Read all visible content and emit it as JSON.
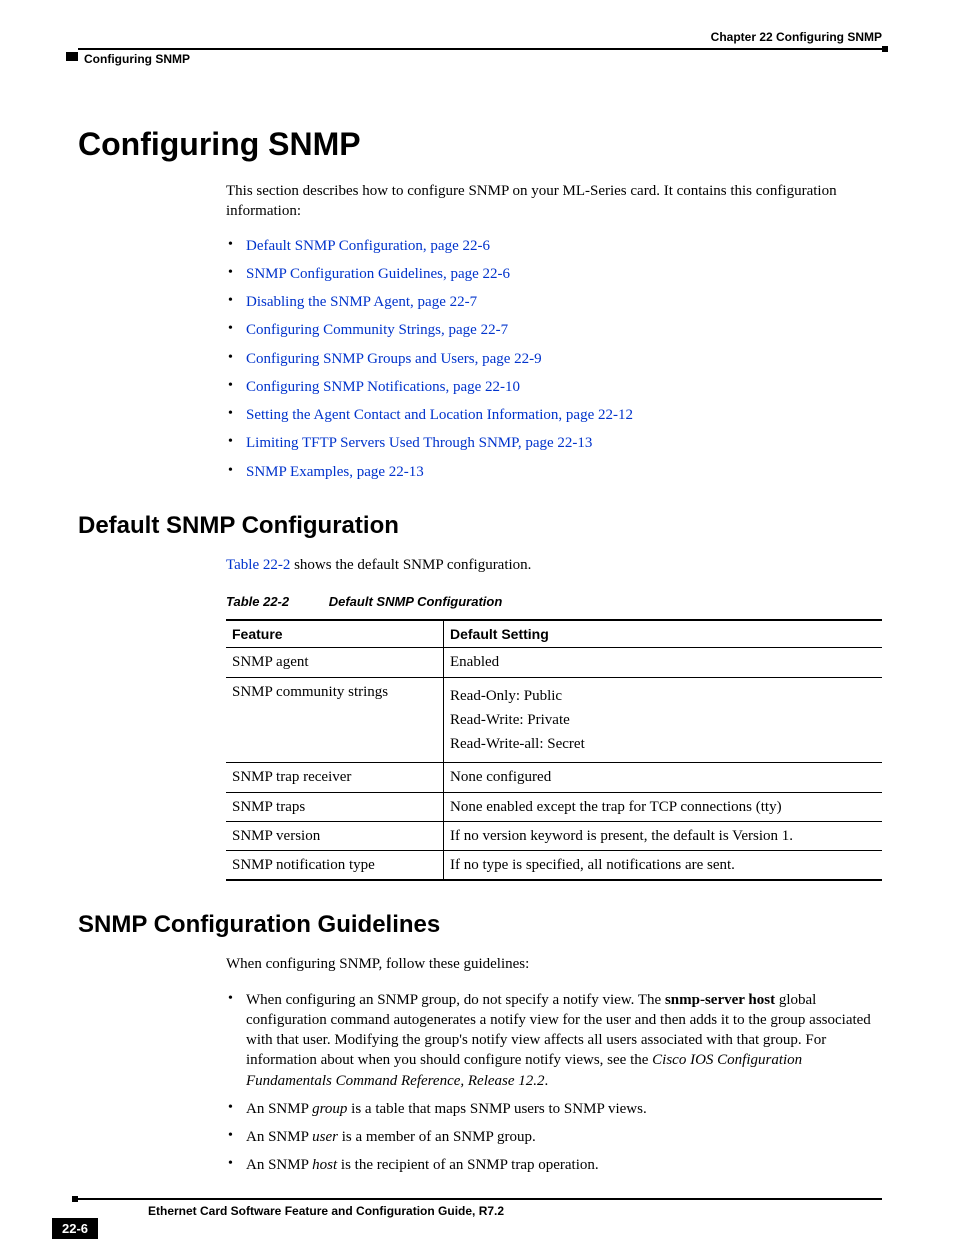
{
  "header": {
    "chapter": "Chapter 22 Configuring SNMP",
    "section": "Configuring SNMP"
  },
  "title": "Configuring SNMP",
  "intro": "This section describes how to configure SNMP on your ML-Series card. It contains this configuration information:",
  "toc": [
    "Default SNMP Configuration, page 22-6",
    "SNMP Configuration Guidelines, page 22-6",
    "Disabling the SNMP Agent, page 22-7",
    "Configuring Community Strings, page 22-7",
    "Configuring SNMP Groups and Users, page 22-9",
    "Configuring SNMP Notifications, page 22-10",
    "Setting the Agent Contact and Location Information, page 22-12",
    "Limiting TFTP Servers Used Through SNMP, page 22-13",
    "SNMP Examples, page 22-13"
  ],
  "section1": {
    "title": "Default SNMP Configuration",
    "lead_link": "Table 22-2",
    "lead_rest": " shows the default SNMP configuration.",
    "caption_no": "Table 22-2",
    "caption_title": "Default SNMP Configuration",
    "headers": [
      "Feature",
      "Default Setting"
    ],
    "rows": [
      {
        "feature": "SNMP agent",
        "setting": [
          "Enabled"
        ]
      },
      {
        "feature": "SNMP community strings",
        "setting": [
          "Read-Only: Public",
          "Read-Write: Private",
          "Read-Write-all: Secret"
        ]
      },
      {
        "feature": "SNMP trap receiver",
        "setting": [
          "None configured"
        ]
      },
      {
        "feature": "SNMP traps",
        "setting": [
          "None enabled except the trap for TCP connections (tty)"
        ]
      },
      {
        "feature": "SNMP version",
        "setting": [
          "If no version keyword is present, the default is Version 1."
        ]
      },
      {
        "feature": "SNMP notification type",
        "setting": [
          "If no type is specified, all notifications are sent."
        ]
      }
    ]
  },
  "section2": {
    "title": "SNMP Configuration Guidelines",
    "lead": "When configuring SNMP, follow these guidelines:",
    "b1a": "When configuring an SNMP group, do not specify a notify view. The ",
    "b1bold": "snmp-server host",
    "b1b": " global configuration command autogenerates a notify view for the user and then adds it to the group associated with that user. Modifying the group's notify view affects all users associated with that group. For information about when you should configure notify views, see the ",
    "b1italic": "Cisco IOS Configuration Fundamentals Command Reference, Release 12.2",
    "b1c": ".",
    "b2a": "An SNMP ",
    "b2i": "group",
    "b2b": " is a table that maps SNMP users to SNMP views.",
    "b3a": "An SNMP ",
    "b3i": "user",
    "b3b": " is a member of an SNMP group.",
    "b4a": "An SNMP ",
    "b4i": "host",
    "b4b": " is the recipient of an SNMP trap operation."
  },
  "footer": {
    "book": "Ethernet Card Software Feature and Configuration Guide, R7.2",
    "page": "22-6"
  }
}
